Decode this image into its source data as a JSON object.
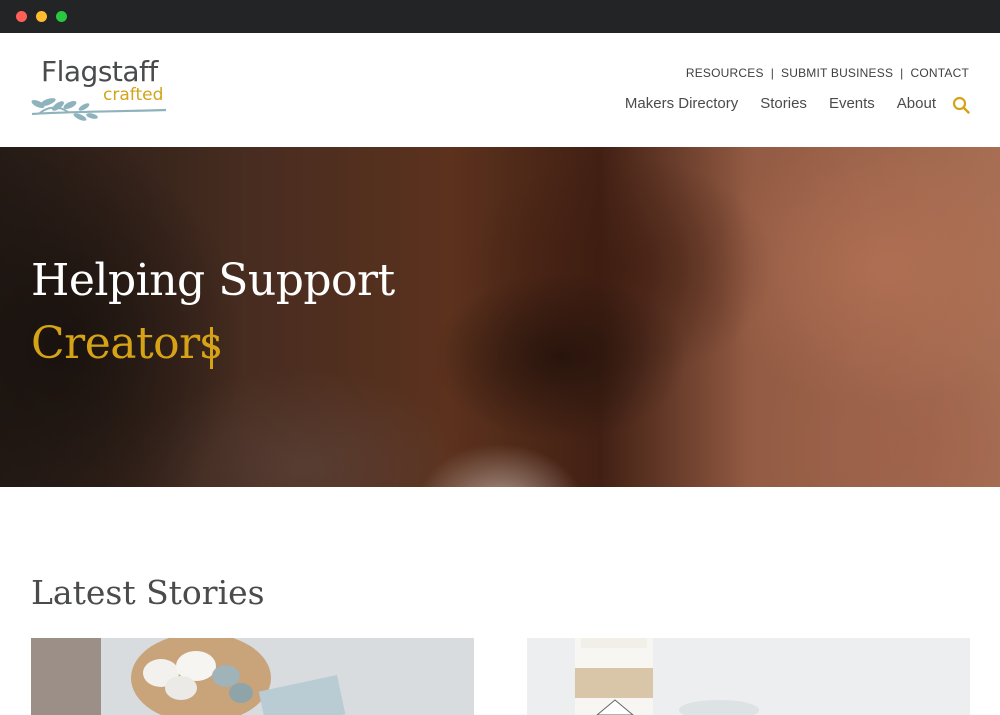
{
  "header": {
    "logo": {
      "word": "Flagstaff",
      "sub": "crafted"
    },
    "utility_nav": [
      "RESOURCES",
      "SUBMIT BUSINESS",
      "CONTACT"
    ],
    "main_nav": [
      "Makers Directory",
      "Stories",
      "Events",
      "About"
    ],
    "search_icon": "search-icon"
  },
  "hero": {
    "title": "Helping Support",
    "subtitle": "Creators"
  },
  "stories": {
    "heading": "Latest Stories"
  },
  "colors": {
    "accent": "#d6a317",
    "text": "#4a4b4c",
    "logo_branch": "#8fb3bd"
  }
}
